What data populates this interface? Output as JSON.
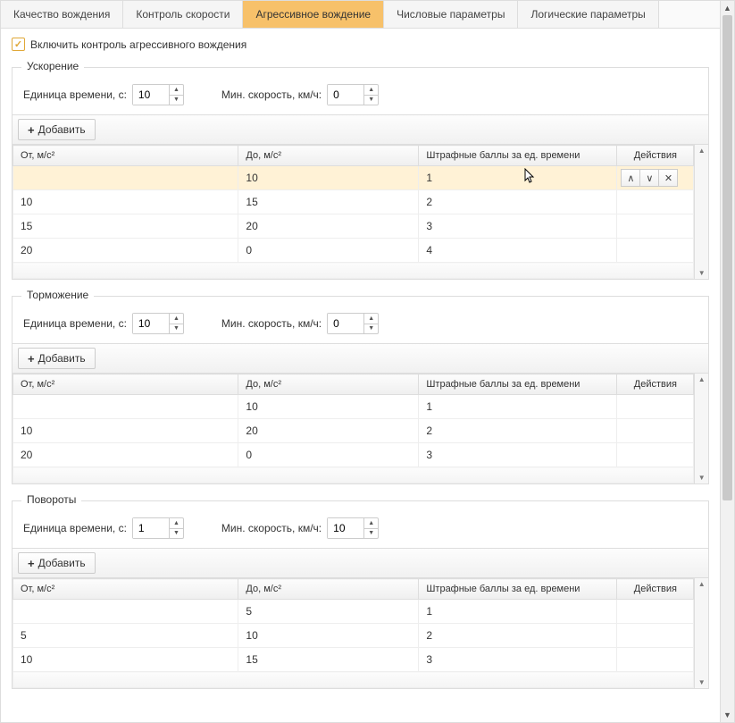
{
  "tabs": [
    {
      "label": "Качество вождения",
      "active": false
    },
    {
      "label": "Контроль скорости",
      "active": false
    },
    {
      "label": "Агрессивное вождение",
      "active": true
    },
    {
      "label": "Числовые параметры",
      "active": false
    },
    {
      "label": "Логические параметры",
      "active": false
    }
  ],
  "checkbox_label": "Включить контроль агрессивного вождения",
  "labels": {
    "time_unit": "Единица времени, с:",
    "min_speed": "Мин. скорость, км/ч:",
    "add": "Добавить"
  },
  "columns": {
    "from": "От, м/с²",
    "to": "До, м/с²",
    "points": "Штрафные баллы за ед. времени",
    "actions": "Действия"
  },
  "sections": [
    {
      "title": "Ускорение",
      "time_unit": "10",
      "min_speed": "0",
      "rows": [
        {
          "from": "",
          "to": "10",
          "points": "1",
          "selected": true,
          "show_actions": true
        },
        {
          "from": "10",
          "to": "15",
          "points": "2"
        },
        {
          "from": "15",
          "to": "20",
          "points": "3"
        },
        {
          "from": "20",
          "to": "0",
          "points": "4"
        }
      ]
    },
    {
      "title": "Торможение",
      "time_unit": "10",
      "min_speed": "0",
      "rows": [
        {
          "from": "",
          "to": "10",
          "points": "1"
        },
        {
          "from": "10",
          "to": "20",
          "points": "2"
        },
        {
          "from": "20",
          "to": "0",
          "points": "3"
        }
      ]
    },
    {
      "title": "Повороты",
      "time_unit": "1",
      "min_speed": "10",
      "rows": [
        {
          "from": "",
          "to": "5",
          "points": "1"
        },
        {
          "from": "5",
          "to": "10",
          "points": "2"
        },
        {
          "from": "10",
          "to": "15",
          "points": "3"
        }
      ]
    }
  ]
}
